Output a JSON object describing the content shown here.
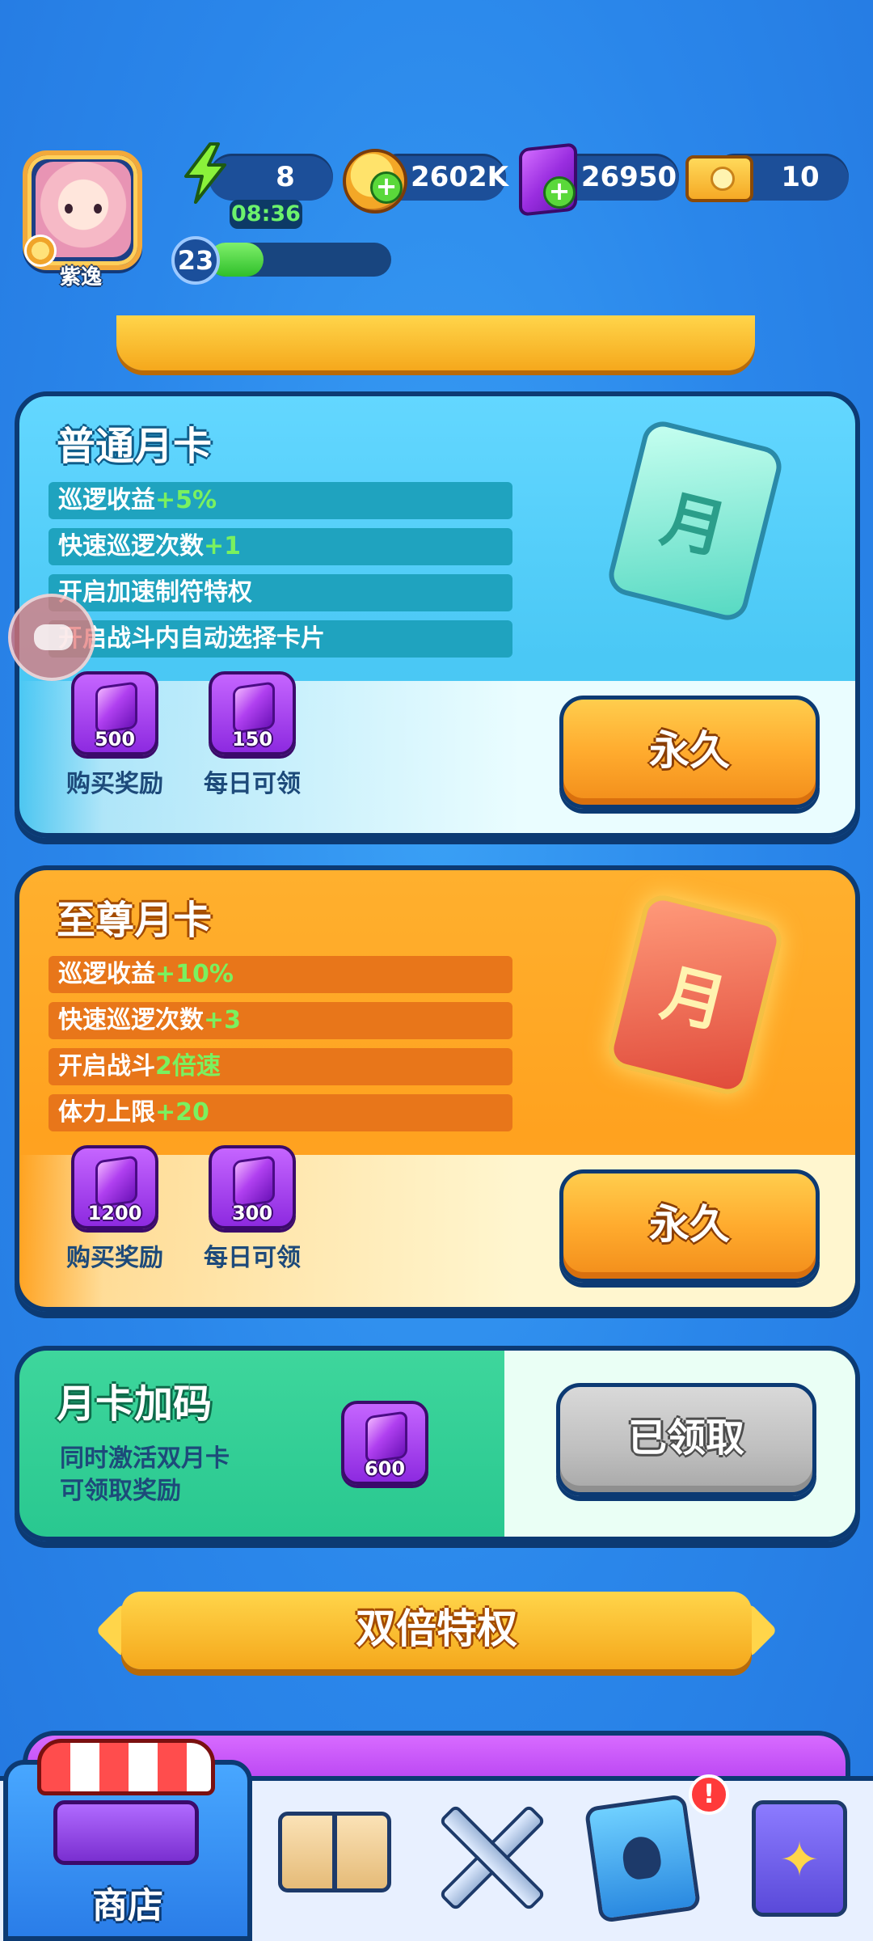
{
  "hud": {
    "player_name": "紫逸",
    "energy": "8",
    "energy_timer": "08:36",
    "coins": "2602K",
    "gems": "26950",
    "tickets": "10",
    "level": "23",
    "level_progress": 0.3
  },
  "cards": {
    "normal": {
      "title": "普通月卡",
      "perks": [
        {
          "text": "巡逻收益",
          "highlight": "+5%"
        },
        {
          "text": "快速巡逻次数",
          "highlight": "+1"
        },
        {
          "text": "开启加速制符特权",
          "highlight": ""
        },
        {
          "text": "开启战斗内自动选择卡片",
          "highlight": ""
        }
      ],
      "purchase_reward": "500",
      "daily_reward": "150",
      "purchase_label": "购买奖励",
      "daily_label": "每日可领",
      "card_glyph": "月",
      "button": "永久"
    },
    "supreme": {
      "title": "至尊月卡",
      "perks": [
        {
          "text": "巡逻收益",
          "highlight": "+10%"
        },
        {
          "text": "快速巡逻次数",
          "highlight": "+3"
        },
        {
          "text": "开启战斗",
          "highlight": "2倍速"
        },
        {
          "text": "体力上限",
          "highlight": "+20"
        }
      ],
      "purchase_reward": "1200",
      "daily_reward": "300",
      "purchase_label": "购买奖励",
      "daily_label": "每日可领",
      "card_glyph": "月",
      "button": "永久"
    },
    "bonus": {
      "title": "月卡加码",
      "desc_line1": "同时激活双月卡",
      "desc_line2": "可领取奖励",
      "reward": "600",
      "button": "已领取"
    }
  },
  "sections": {
    "double_privilege": "双倍特权"
  },
  "bottom_nav": {
    "shop_label": "商店",
    "alert": "!"
  }
}
